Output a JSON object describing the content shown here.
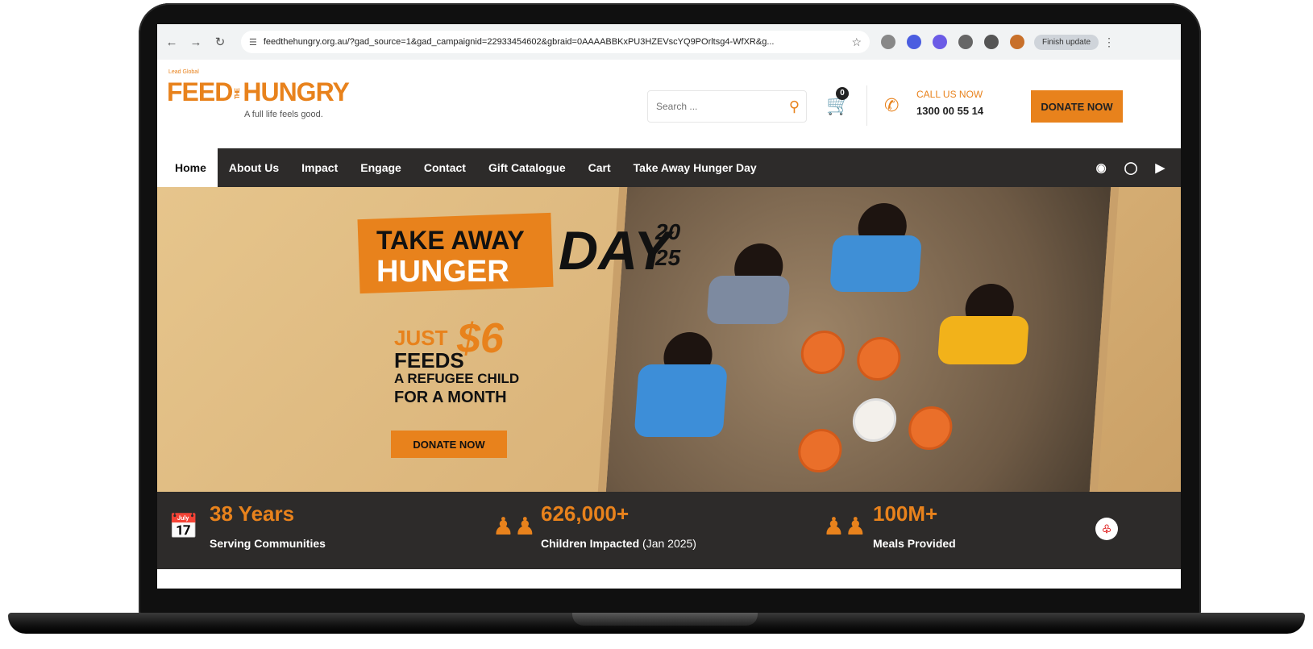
{
  "browser": {
    "url": "feedthehungry.org.au/?gad_source=1&gad_campaignid=22933454602&gbraid=0AAAABBKxPU3HZEVscYQ9POrltsg4-WfXR&g...",
    "update_label": "Finish update"
  },
  "header": {
    "logo_small": "Lead Global",
    "logo_feed": "FEED",
    "logo_the": "THE",
    "logo_hungry": "HUNGRY",
    "tagline": "A full life feels good.",
    "search_placeholder": "Search ...",
    "cart_count": "0",
    "call_label": "CALL US NOW",
    "call_number": "1300 00 55 14",
    "donate_label": "DONATE NOW"
  },
  "nav": {
    "items": [
      {
        "label": "Home"
      },
      {
        "label": "About Us"
      },
      {
        "label": "Impact"
      },
      {
        "label": "Engage"
      },
      {
        "label": "Contact"
      },
      {
        "label": "Gift Catalogue"
      },
      {
        "label": "Cart"
      },
      {
        "label": "Take Away Hunger Day"
      }
    ]
  },
  "hero": {
    "line1": "TAKE AWAY",
    "line2": "HUNGER",
    "day": "DAY",
    "year_top": "20",
    "year_bottom": "25",
    "just": "JUST",
    "amount": "$6",
    "feeds": "FEEDS",
    "line3": "A REFUGEE CHILD",
    "line4": "FOR A MONTH",
    "donate_label": "DONATE NOW"
  },
  "stats": [
    {
      "value": "38 Years",
      "label": "Serving Communities",
      "sub": ""
    },
    {
      "value": "626,000+",
      "label": "Children Impacted",
      "sub": " (Jan 2025)"
    },
    {
      "value": "100M+",
      "label": "Meals Provided",
      "sub": ""
    }
  ],
  "colors": {
    "accent": "#e8821c",
    "nav_bg": "#2d2b2a"
  }
}
